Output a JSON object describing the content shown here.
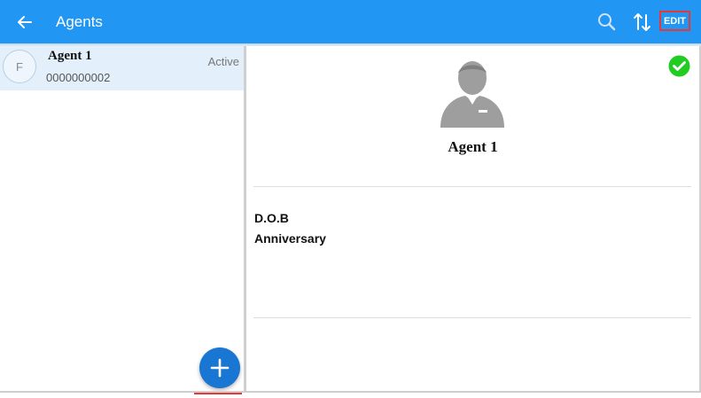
{
  "appbar": {
    "title": "Agents",
    "back_icon": "arrow-left-icon",
    "search_icon": "search-icon",
    "sort_icon": "sort-icon",
    "edit_label": "EDIT",
    "color": "#2196f3"
  },
  "agent_list": {
    "items": [
      {
        "initial": "F",
        "name": "Agent 1",
        "phone": "0000000002",
        "status": "Active"
      }
    ],
    "add_icon": "plus-icon"
  },
  "detail": {
    "name": "Agent 1",
    "avatar_icon": "user-silhouette-icon",
    "status_icon": "check-circle-icon",
    "status_color": "#22cc22",
    "fields": {
      "dob_label": "D.O.B",
      "anniversary_label": "Anniversary"
    }
  }
}
